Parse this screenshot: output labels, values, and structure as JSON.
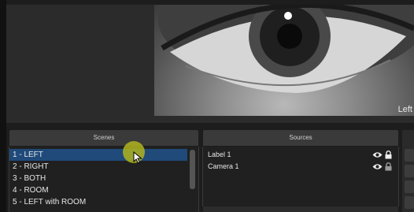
{
  "preview": {
    "camera_label": "Left"
  },
  "scenes": {
    "header": "Scenes",
    "items": [
      {
        "label": "1 - LEFT",
        "selected": true
      },
      {
        "label": "2 - RIGHT",
        "selected": false
      },
      {
        "label": "3 - BOTH",
        "selected": false
      },
      {
        "label": "4 - ROOM",
        "selected": false
      },
      {
        "label": "5 - LEFT with ROOM",
        "selected": false
      }
    ]
  },
  "sources": {
    "header": "Sources",
    "items": [
      {
        "label": "Label 1",
        "visible": true,
        "locked": true
      },
      {
        "label": "Camera 1",
        "visible": true,
        "locked": true
      }
    ]
  },
  "icons": {
    "visibility": "eye-icon",
    "lock": "lock-icon",
    "pointer": "mouse-cursor-icon"
  },
  "colors": {
    "selection": "#1f4a7a",
    "cursor_highlight": "#b0b41e",
    "panel_header": "#3a3a3a"
  }
}
